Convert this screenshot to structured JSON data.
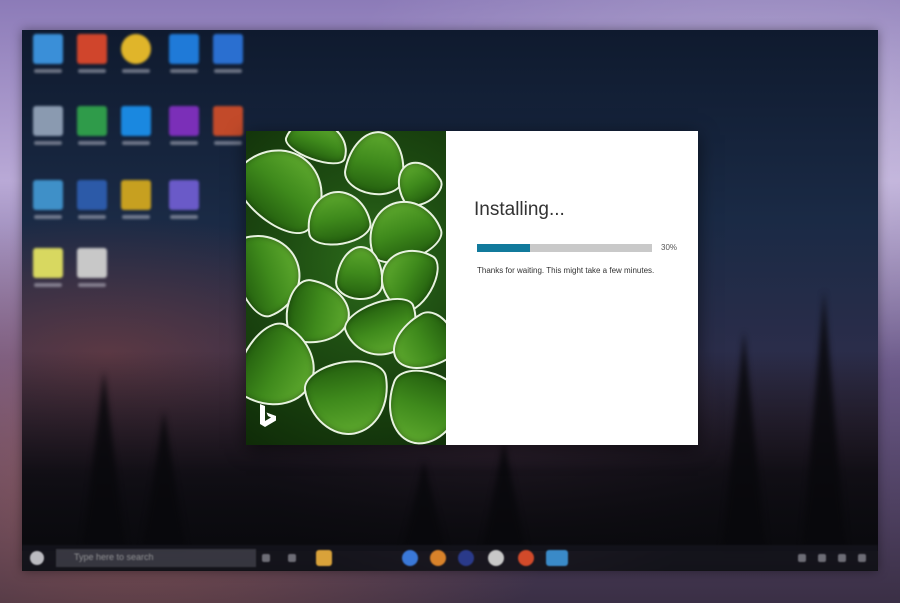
{
  "installer": {
    "title": "Installing...",
    "progress": {
      "percent_label": "30%",
      "value": 0.3,
      "fill_color": "#117a9c",
      "track_color": "#c9c9c9"
    },
    "message": "Thanks for waiting. This might take a few minutes.",
    "brand_logo_icon": "bing-logo-icon"
  },
  "desktop": {
    "icons": [
      {
        "name": "desktop-icon-1",
        "color": "#3a8fd8"
      },
      {
        "name": "desktop-icon-2",
        "color": "#d0452c"
      },
      {
        "name": "desktop-icon-3",
        "color": "#e0b52a"
      },
      {
        "name": "desktop-icon-4",
        "color": "#1f7ad8"
      },
      {
        "name": "desktop-icon-5",
        "color": "#2a6fd0"
      },
      {
        "name": "desktop-icon-6",
        "color": "#8a9ab0"
      },
      {
        "name": "desktop-icon-7",
        "color": "#2f9b4a"
      },
      {
        "name": "desktop-icon-8",
        "color": "#1a88e0"
      },
      {
        "name": "desktop-icon-9",
        "color": "#7b2fb8"
      },
      {
        "name": "desktop-icon-10",
        "color": "#c24a2a"
      },
      {
        "name": "desktop-icon-11",
        "color": "#3f90c8"
      },
      {
        "name": "desktop-icon-12",
        "color": "#2c5aa8"
      },
      {
        "name": "desktop-icon-13",
        "color": "#c7a020"
      },
      {
        "name": "desktop-icon-14",
        "color": "#6a5ac8"
      },
      {
        "name": "desktop-icon-15",
        "color": "#d8d860"
      },
      {
        "name": "desktop-icon-16",
        "color": "#c8c8c8"
      }
    ]
  },
  "taskbar": {
    "search_placeholder": "Type here to search",
    "apps": [
      {
        "name": "taskbar-app-1",
        "color": "#d9a23a"
      },
      {
        "name": "taskbar-app-2",
        "color": "#3a78d8"
      },
      {
        "name": "taskbar-app-3",
        "color": "#d8822a"
      },
      {
        "name": "taskbar-app-4",
        "color": "#2a3a8a"
      },
      {
        "name": "taskbar-app-5",
        "color": "#c8c8c8"
      },
      {
        "name": "taskbar-app-6",
        "color": "#d24a2a"
      },
      {
        "name": "taskbar-app-7",
        "color": "#3a8ac8"
      }
    ]
  }
}
